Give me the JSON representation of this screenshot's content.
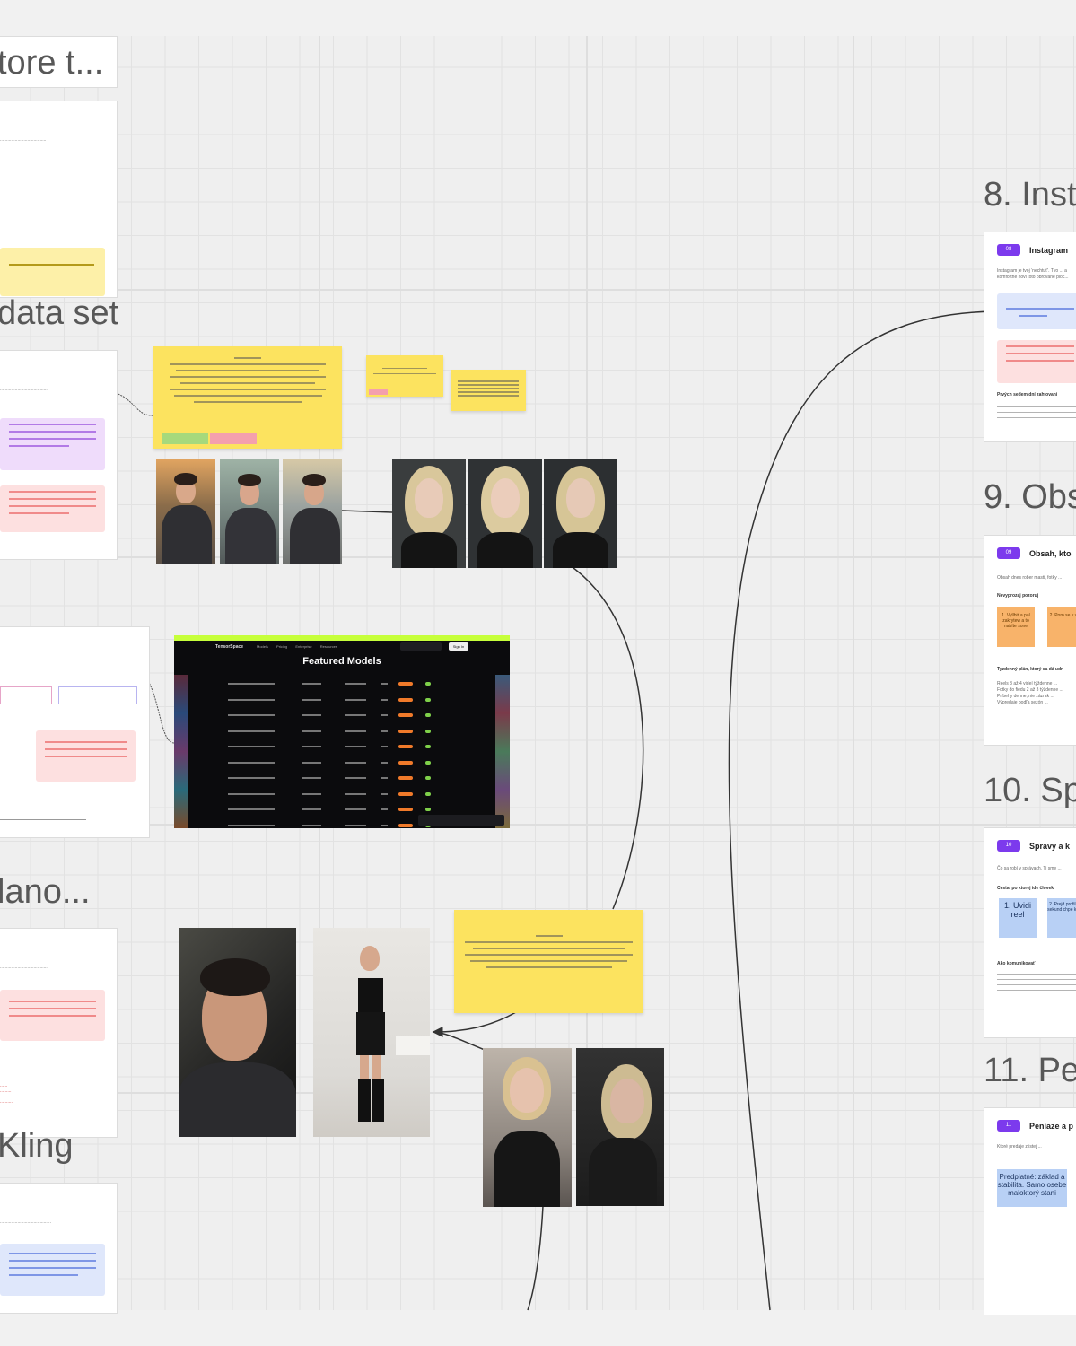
{
  "board": {
    "left_headings": [
      "tore t...",
      "data set",
      "lano...",
      "Kling"
    ],
    "right_headings": [
      "8. Inst",
      "9. Obs",
      "10. Sp",
      "11. Pe"
    ]
  },
  "right_cards": [
    {
      "badge": "08",
      "title": "Instagram",
      "text": "Instagram je tvoj ‘nechtuť’. Tvo ... a komfortne novi toto obrovane ploc...",
      "footer": "Prvých sedem dní zahtovani"
    },
    {
      "badge": "09",
      "title": "Obsah, kto",
      "text": "Obsah dnes rober masti, fotky ...",
      "section": "Nevyprozaj pozoruj",
      "notes": [
        "1. Vyllbiť a pal zakrytew a to nabíte sone",
        "2. Porn se k vlsy"
      ],
      "plan": "Tyzdenný plán, ktorý sa dá udr",
      "rows": [
        "Reels 3 až 4 videí týždenne ...",
        "Fotky do fiedu 2 až 3 týždenne ...",
        "Príbehy denne, nie zázrak ...",
        "Výpredaje podľa sezón ..."
      ]
    },
    {
      "badge": "10",
      "title": "Spravy a k",
      "text": "Čo sa robí v správach. Ti sme ...",
      "section": "Cesta, po ktorej ide človek",
      "notes": [
        "1. Uvidi reel",
        "2. Prejd profil, do sekund chpe kto je"
      ],
      "footer": "Ako komunikovať"
    },
    {
      "badge": "11",
      "title": "Peniaze a p",
      "text": "Ktoré predaje z istej ...",
      "note": "Predplatné: základ a stabilita. Samo osebe maloktorý stani"
    }
  ],
  "screenshot": {
    "title": "Featured Models",
    "brand": "TensorSpace",
    "nav": [
      "Models",
      "Pricing",
      "Enterprise",
      "Resources"
    ],
    "search_placeholder": "Search Models",
    "signin": "Sign In",
    "rows": 10
  },
  "colors": {
    "sticky": "#fce35f",
    "accent_purple": "#7c3aed",
    "pink_block": "#fde0e0",
    "violet_block": "#efdcfb",
    "blue_block": "#dfe7fb",
    "orange_note": "#f8b36a",
    "blue_note": "#b8d0f5",
    "screenshot_accent": "#c6ff3a"
  }
}
